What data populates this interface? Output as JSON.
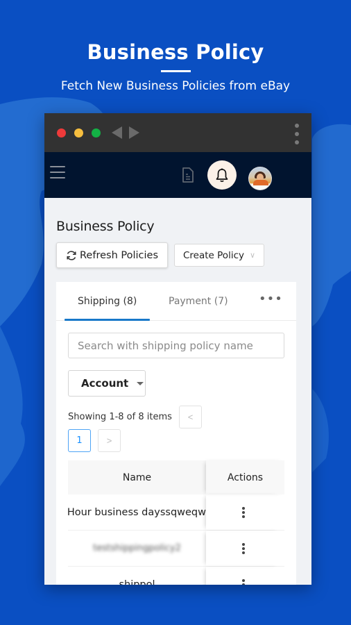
{
  "promo": {
    "title": "Business Policy",
    "subtitle": "Fetch New Business Policies from eBay"
  },
  "colors": {
    "background": "#0a4fc2",
    "chrome_bar": "#323232",
    "app_bar": "#01142f",
    "accent": "#1979c9",
    "page_number_active": "#1890ff"
  },
  "browser": {
    "window_controls": [
      "close",
      "minimize",
      "maximize"
    ],
    "nav": [
      "back-arrow-icon",
      "forward-arrow-icon"
    ],
    "menu_icon": "vertical-kebab-icon"
  },
  "appbar": {
    "menu_icon": "hamburger-icon",
    "icons": [
      "document-icon",
      "bell-icon",
      "avatar"
    ]
  },
  "page": {
    "title": "Business Policy",
    "refresh_label": "Refresh Policies",
    "create_label": "Create Policy",
    "create_chevron": "∨"
  },
  "tabs": [
    {
      "label": "Shipping (8)",
      "active": true
    },
    {
      "label": "Payment (7)",
      "active": false
    },
    {
      "label": "•••",
      "active": false
    }
  ],
  "filters": {
    "search_placeholder": "Search with shipping policy name",
    "account_label": "Account"
  },
  "pagination": {
    "summary": "Showing 1-8 of 8 items",
    "prev": "<",
    "current_page": "1",
    "next": ">"
  },
  "table": {
    "columns": [
      "Name",
      "Actions"
    ],
    "rows": [
      {
        "name": "ner Hour business dayssqweqw"
      },
      {
        "name": "testshippingpolicy2"
      },
      {
        "name": "shippol"
      }
    ]
  }
}
